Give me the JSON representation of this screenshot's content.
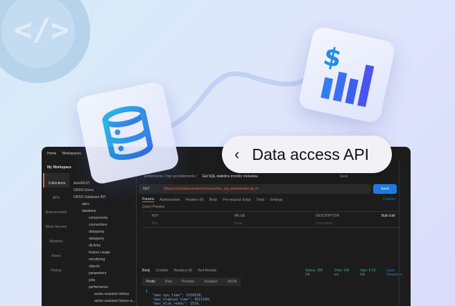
{
  "hero": {
    "title": "Data access API",
    "back_icon": "chevron-left-icon",
    "icons": [
      "code-gear-icon",
      "database-icon",
      "dollar-chart-icon"
    ],
    "accent": "#1f7ae0"
  },
  "app": {
    "topbar": {
      "home": "Home",
      "workspaces": "Workspaces"
    },
    "workspace": "My Workspace",
    "rail": [
      "Collections",
      "APIs",
      "Environments",
      "Mock Servers",
      "Monitors",
      "Flows",
      "History"
    ],
    "tree": [
      "AutoREST",
      "ORDS Demo",
      "ORDS Database API",
      "apex",
      "database",
      "components",
      "connections",
      "datapump",
      "dataquery",
      "db links",
      "feature usage",
      "monitoring",
      "objects",
      "parameters",
      "jobs",
      "performance",
      "active sessions history",
      "active sessions history w..."
    ],
    "breadcrumb": "performance / top sql statements /",
    "request_name": "Get SQL statistics monitor metadata",
    "method": "GET",
    "url": "{{baseUrl}}/database/performance/top_sql_statements/:sql_id",
    "send": "Send",
    "save": "Save",
    "req_tabs": [
      "Params",
      "Authorization",
      "Headers (6)",
      "Body",
      "Pre-request Script",
      "Tests",
      "Settings"
    ],
    "cookies": "Cookies",
    "query_params": "Query Params",
    "cols": [
      "KEY",
      "VALUE",
      "DESCRIPTION",
      "Bulk Edit"
    ],
    "placeholders": [
      "Key",
      "Value",
      "Description"
    ],
    "resp_tabs": [
      "Body",
      "Cookies",
      "Headers (4)",
      "Test Results"
    ],
    "status": "Status: 200 OK",
    "time": "Time: 145 ms",
    "size": "Size: 6.19 KB",
    "save_response": "Save Response",
    "view_tabs": [
      "Pretty",
      "Raw",
      "Preview",
      "Visualize"
    ],
    "format": "JSON",
    "code": [
      "{",
      "\"max_cpu_time\": 2150530,",
      "\"max_elapsed_time\": 4511160,",
      "\"max_disk_reads\": 2516,"
    ]
  }
}
